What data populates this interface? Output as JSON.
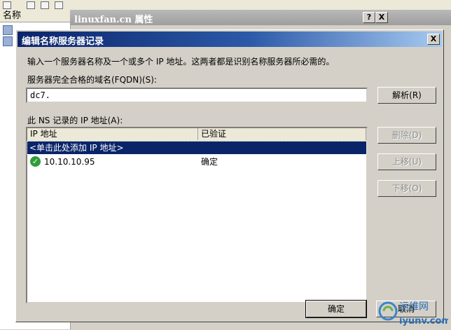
{
  "background": {
    "list_header": "名称",
    "window_title": "linuxfan.cn 属性",
    "help_button": "?",
    "close_button": "X"
  },
  "dialog": {
    "title": "编辑名称服务器记录",
    "close_button": "X",
    "description": "输入一个服务器名称及一个或多个 IP 地址。这两者都是识别名称服务器所必需的。",
    "fqdn_label": "服务器完全合格的域名(FQDN)(S):",
    "fqdn_value": "dc7.",
    "resolve_button": "解析(R)",
    "ip_list_label": "此 NS 记录的 IP 地址(A):",
    "columns": [
      "IP 地址",
      "已验证"
    ],
    "placeholder_row": "<单击此处添加 IP 地址>",
    "rows": [
      {
        "ip": "10.10.10.95",
        "verified": "确定"
      }
    ],
    "delete_button": "删除(D)",
    "move_up_button": "上移(U)",
    "move_down_button": "下移(O)",
    "ok_button": "确定",
    "cancel_button": "取消"
  },
  "watermark": {
    "text1": "运维网",
    "text2": "iyunv.com"
  },
  "colors": {
    "titlebar": "#0a246a",
    "selection": "#0a246a",
    "face": "#d4d0c8",
    "check": "#2f9d3a"
  }
}
